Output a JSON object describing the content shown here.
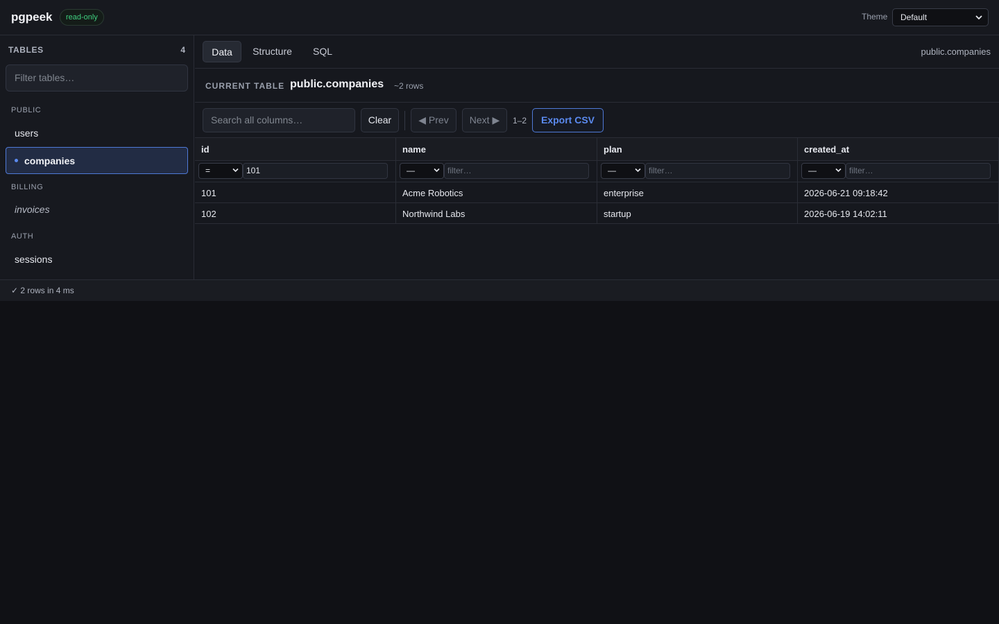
{
  "header": {
    "app_name": "pgpeek",
    "mode_badge": "read-only",
    "theme_label": "Theme",
    "theme_value": "Default"
  },
  "sidebar": {
    "title": "TABLES",
    "count": "4",
    "filter_placeholder": "Filter tables…",
    "groups": [
      {
        "schema": "PUBLIC",
        "tables": [
          "users",
          "companies"
        ]
      },
      {
        "schema": "BILLING",
        "tables": [
          "invoices"
        ]
      },
      {
        "schema": "AUTH",
        "tables": [
          "sessions"
        ]
      }
    ],
    "active_table": "companies"
  },
  "tabs": [
    "Data",
    "Structure",
    "SQL"
  ],
  "active_tab": "Data",
  "breadcrumb": "public.companies",
  "current_table": {
    "label": "CURRENT TABLE",
    "name": "public.companies",
    "row_estimate": "~2 rows"
  },
  "toolbar": {
    "search_placeholder": "Search all columns…",
    "clear": "Clear",
    "prev": "◀ Prev",
    "next": "Next ▶",
    "range": "1–2",
    "export": "Export CSV"
  },
  "grid": {
    "columns": [
      "id",
      "name",
      "plan",
      "created_at"
    ],
    "filters": [
      {
        "op": "=",
        "value": "101",
        "placeholder": ""
      },
      {
        "op": "—",
        "value": "",
        "placeholder": "filter…"
      },
      {
        "op": "—",
        "value": "",
        "placeholder": "filter…"
      },
      {
        "op": "—",
        "value": "",
        "placeholder": "filter…"
      }
    ],
    "rows": [
      [
        "101",
        "Acme Robotics",
        "enterprise",
        "2026-06-21 09:18:42"
      ],
      [
        "102",
        "Northwind Labs",
        "startup",
        "2026-06-19 14:02:11"
      ]
    ]
  },
  "status": "✓ 2 rows in 4 ms",
  "colors": {
    "accent": "#5b8af0",
    "success": "#3fcf7f",
    "background": "#101115"
  }
}
